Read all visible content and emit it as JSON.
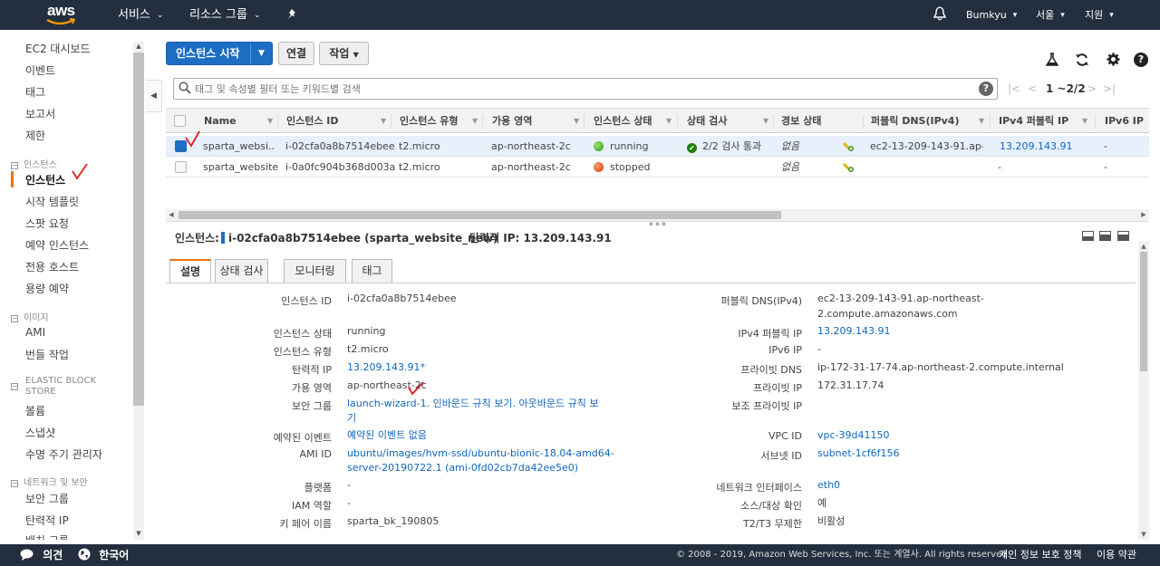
{
  "topnav": {
    "logo": "aws",
    "services": "서비스",
    "resource_groups": "리소스 그룹",
    "user": "Bumkyu",
    "region": "서울",
    "support": "지원",
    "icons": [
      "pin-icon",
      "bell-icon"
    ]
  },
  "sidebar": {
    "items_top": [
      "EC2 대시보드",
      "이벤트",
      "태그",
      "보고서",
      "제한"
    ],
    "sections": [
      {
        "header": "인스턴스",
        "items": [
          "인스턴스",
          "시작 템플릿",
          "스팟 요청",
          "예약 인스턴스",
          "전용 호스트",
          "용량 예약"
        ]
      },
      {
        "header": "이미지",
        "items": [
          "AMI",
          "번들 작업"
        ]
      },
      {
        "header": "ELASTIC BLOCK STORE",
        "items": [
          "볼륨",
          "스냅샷",
          "수명 주기 관리자"
        ]
      },
      {
        "header": "네트워크 및 보안",
        "items": [
          "보안 그룹",
          "탄력적 IP",
          "배치 그룹"
        ]
      }
    ],
    "active": "인스턴스"
  },
  "toolbar": {
    "launch": "인스턴스 시작",
    "connect": "연결",
    "actions": "작업",
    "icons": [
      "flask-icon",
      "refresh-icon",
      "gear-icon",
      "help-icon"
    ]
  },
  "search": {
    "placeholder": "태그 및 속성별 필터 또는 키워드별 검색",
    "pager": "1 ~2/2"
  },
  "table": {
    "columns": [
      "Name",
      "인스턴스 ID",
      "인스턴스 유형",
      "가용 영역",
      "인스턴스 상태",
      "상태 검사",
      "경보 상태",
      "퍼블릭 DNS(IPv4)",
      "IPv4 퍼블릭 IP",
      "IPv6 IP"
    ],
    "rows": [
      {
        "name": "sparta_websi...",
        "id": "i-02cfa0a8b7514ebee",
        "type": "t2.micro",
        "az": "ap-northeast-2c",
        "state": "running",
        "state_color": "#3fb72a",
        "check": "2/2 검사 통과",
        "alarm": "없음",
        "dns": "ec2-13-209-143-91.ap-...",
        "ipv4": "13.209.143.91",
        "ipv6": "-",
        "selected": true
      },
      {
        "name": "sparta_website",
        "id": "i-0a0fc904b368d003a",
        "type": "t2.micro",
        "az": "ap-northeast-2c",
        "state": "stopped",
        "state_color": "#e0561a",
        "check": "",
        "alarm": "없음",
        "dns": "",
        "ipv4": "-",
        "ipv6": "-",
        "selected": false
      }
    ]
  },
  "detail": {
    "label": "인스턴스:",
    "instance": "i-02cfa0a8b7514ebee (sparta_website_new)",
    "eip": "탄력적 IP: 13.209.143.91",
    "tabs": [
      "설명",
      "상태 검사",
      "모니터링",
      "태그"
    ],
    "left": [
      {
        "k": "인스턴스 ID",
        "v": "i-02cfa0a8b7514ebee"
      },
      {
        "k": "인스턴스 상태",
        "v": "running"
      },
      {
        "k": "인스턴스 유형",
        "v": "t2.micro"
      },
      {
        "k": "탄력적 IP",
        "v": "13.209.143.91*"
      },
      {
        "k": "가용 영역",
        "v": "ap-northeast-2c"
      },
      {
        "k": "보안 그룹",
        "v": "launch-wizard-1. 인바운드 규칙 보기. 아웃바운드 규칙 보",
        "v2": "기"
      },
      {
        "k": "예약된 이벤트",
        "v": "예약된 이벤트 없음"
      },
      {
        "k": "AMI ID",
        "v": "ubuntu/images/hvm-ssd/ubuntu-bionic-18.04-amd64-",
        "v2": "server-20190722.1 (ami-0fd02cb7da42ee5e0)"
      },
      {
        "k": "플랫폼",
        "v": "-"
      },
      {
        "k": "IAM 역할",
        "v": "-"
      },
      {
        "k": "키 페어 이름",
        "v": "sparta_bk_190805"
      }
    ],
    "right": [
      {
        "k": "퍼블릭 DNS(IPv4)",
        "v": "ec2-13-209-143-91.ap-northeast-",
        "v2": "2.compute.amazonaws.com"
      },
      {
        "k": "IPv4 퍼블릭 IP",
        "v": "13.209.143.91"
      },
      {
        "k": "IPv6 IP",
        "v": "-"
      },
      {
        "k": "프라이빗 DNS",
        "v": "ip-172-31-17-74.ap-northeast-2.compute.internal"
      },
      {
        "k": "프라이빗 IP",
        "v": "172.31.17.74"
      },
      {
        "k": "보조 프라이빗 IP",
        "v": ""
      },
      {
        "k": "VPC ID",
        "v": "vpc-39d41150"
      },
      {
        "k": "서브넷 ID",
        "v": "subnet-1cf6f156"
      },
      {
        "k": "네트워크 인터페이스",
        "v": "eth0"
      },
      {
        "k": "소스/대상 확인",
        "v": "예"
      },
      {
        "k": "T2/T3 무제한",
        "v": "비활성"
      }
    ]
  },
  "footer": {
    "feedback": "의견",
    "language": "한국어",
    "copyright": "© 2008 - 2019, Amazon Web Services, Inc. 또는 계열사. All rights reserved.",
    "privacy": "개인 정보 보호 정책",
    "terms": "이용 약관"
  },
  "colors": {
    "nav": "#232f3e",
    "primary": "#1d6ec3",
    "accent": "#ec7211",
    "link": "#1166bb"
  }
}
